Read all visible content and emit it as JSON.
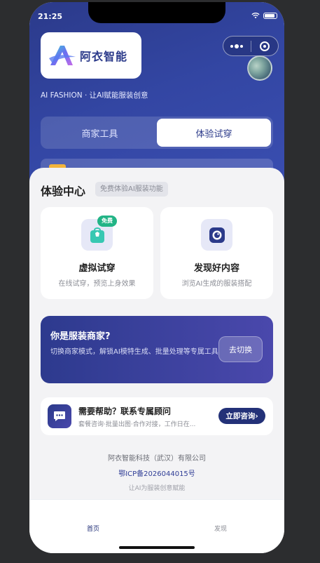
{
  "status_bar": {
    "time": "21:25"
  },
  "header": {
    "logo_text": "阿衣智能",
    "tagline": "AI FASHION · 让AI赋能服装创意"
  },
  "mode_tabs": [
    {
      "label": "商家工具",
      "active": false
    },
    {
      "label": "体验试穿",
      "active": true
    }
  ],
  "experience": {
    "title": "体验中心",
    "tag": "免费体验AI服装功能",
    "cards": [
      {
        "title": "虚拟试穿",
        "subtitle": "在线试穿，预览上身效果",
        "badge": "免费",
        "icon": "shirt-bag-icon"
      },
      {
        "title": "发现好内容",
        "subtitle": "浏览AI生成的服装搭配",
        "icon": "camera-lens-icon"
      }
    ]
  },
  "merchant_banner": {
    "title": "你是服装商家?",
    "description": "切换商家模式，解锁AI模特生成、批量处理等专属工具",
    "button": "去切换"
  },
  "help": {
    "title": "需要帮助？联系专属顾问",
    "subtitle": "套餐咨询·批量出图·合作对接，工作日在...",
    "button": "立即咨询›"
  },
  "footer": {
    "company": "阿衣智能科技（武汉）有限公司",
    "icp": "鄂ICP备2026044015号",
    "slogan": "让AI为服装创意赋能"
  },
  "tabbar": [
    {
      "label": "首页",
      "active": true
    },
    {
      "label": "发现",
      "active": false
    }
  ],
  "colors": {
    "brand": "#2b3a8a",
    "accent_green": "#22b486",
    "background": "#f3f3f5"
  }
}
